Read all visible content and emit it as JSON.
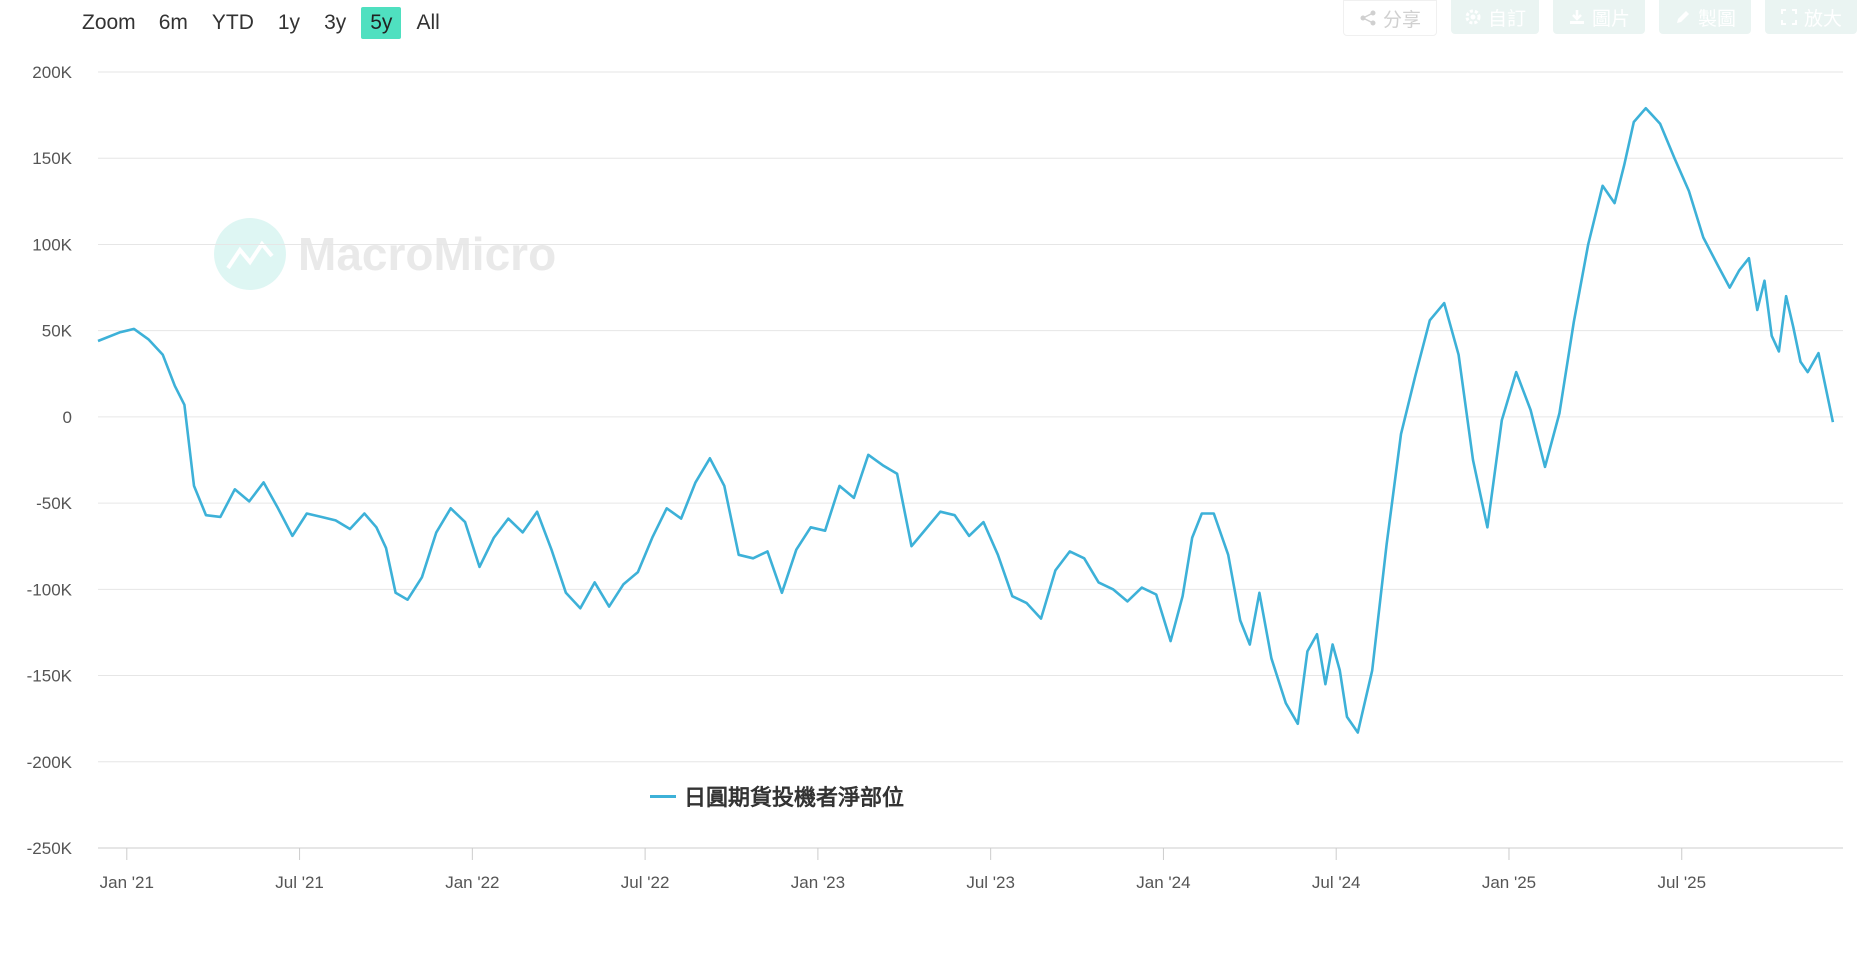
{
  "zoom": {
    "label": "Zoom",
    "options": [
      "6m",
      "YTD",
      "1y",
      "3y",
      "5y",
      "All"
    ],
    "active": "5y"
  },
  "toolbar": {
    "share": "分享",
    "custom": "自訂",
    "image": "圖片",
    "draw": "製圖",
    "expand": "放大"
  },
  "watermark": "MacroMicro",
  "colors": {
    "line": "#3db1d8",
    "active_zoom": "#4fe0c0",
    "grid": "#e6e6e6"
  },
  "chart_data": {
    "type": "line",
    "title": "",
    "xlabel": "",
    "ylabel": "",
    "ylim": [
      -250000,
      200000
    ],
    "y_ticks": [
      "200K",
      "150K",
      "100K",
      "50K",
      "0",
      "-50K",
      "-100K",
      "-150K",
      "-200K",
      "-250K"
    ],
    "y_tick_values": [
      200000,
      150000,
      100000,
      50000,
      0,
      -50000,
      -100000,
      -150000,
      -200000,
      -250000
    ],
    "x_ticks": [
      "Jan '21",
      "Jul '21",
      "Jan '22",
      "Jul '22",
      "Jan '23",
      "Jul '23",
      "Jan '24",
      "Jul '24",
      "Jan '25",
      "Jul '25"
    ],
    "x_tick_dates": [
      "2021-01",
      "2021-07",
      "2022-01",
      "2022-07",
      "2023-01",
      "2023-07",
      "2024-01",
      "2024-07",
      "2025-01",
      "2025-07"
    ],
    "xlim": [
      "2020-12",
      "2025-12"
    ],
    "legend_position": "bottom-center",
    "series": [
      {
        "name": "日圓期貨投機者淨部位",
        "points": [
          [
            "2020-12",
            44000
          ],
          [
            "2021-01",
            49000
          ],
          [
            "2021-01",
            51000
          ],
          [
            "2021-02",
            45000
          ],
          [
            "2021-02",
            36000
          ],
          [
            "2021-03",
            18000
          ],
          [
            "2021-03",
            7000
          ],
          [
            "2021-03",
            -40000
          ],
          [
            "2021-04",
            -57000
          ],
          [
            "2021-04",
            -58000
          ],
          [
            "2021-05",
            -42000
          ],
          [
            "2021-05",
            -49000
          ],
          [
            "2021-06",
            -38000
          ],
          [
            "2021-06",
            -53000
          ],
          [
            "2021-07",
            -69000
          ],
          [
            "2021-07",
            -56000
          ],
          [
            "2021-08",
            -58000
          ],
          [
            "2021-08",
            -60000
          ],
          [
            "2021-09",
            -65000
          ],
          [
            "2021-09",
            -56000
          ],
          [
            "2021-10",
            -64000
          ],
          [
            "2021-10",
            -76000
          ],
          [
            "2021-10",
            -102000
          ],
          [
            "2021-11",
            -106000
          ],
          [
            "2021-11",
            -93000
          ],
          [
            "2021-12",
            -67000
          ],
          [
            "2021-12",
            -53000
          ],
          [
            "2022-01",
            -61000
          ],
          [
            "2022-01",
            -87000
          ],
          [
            "2022-02",
            -70000
          ],
          [
            "2022-02",
            -59000
          ],
          [
            "2022-03",
            -67000
          ],
          [
            "2022-03",
            -55000
          ],
          [
            "2022-04",
            -77000
          ],
          [
            "2022-04",
            -102000
          ],
          [
            "2022-05",
            -111000
          ],
          [
            "2022-05",
            -96000
          ],
          [
            "2022-06",
            -110000
          ],
          [
            "2022-06",
            -97000
          ],
          [
            "2022-07",
            -90000
          ],
          [
            "2022-07",
            -70000
          ],
          [
            "2022-08",
            -53000
          ],
          [
            "2022-08",
            -59000
          ],
          [
            "2022-09",
            -38000
          ],
          [
            "2022-09",
            -24000
          ],
          [
            "2022-10",
            -40000
          ],
          [
            "2022-10",
            -80000
          ],
          [
            "2022-11",
            -82000
          ],
          [
            "2022-11",
            -78000
          ],
          [
            "2022-12",
            -102000
          ],
          [
            "2022-12",
            -77000
          ],
          [
            "2023-01",
            -64000
          ],
          [
            "2023-01",
            -66000
          ],
          [
            "2023-02",
            -40000
          ],
          [
            "2023-02",
            -47000
          ],
          [
            "2023-03",
            -22000
          ],
          [
            "2023-03",
            -28000
          ],
          [
            "2023-04",
            -33000
          ],
          [
            "2023-04",
            -75000
          ],
          [
            "2023-05",
            -65000
          ],
          [
            "2023-05",
            -55000
          ],
          [
            "2023-06",
            -57000
          ],
          [
            "2023-06",
            -69000
          ],
          [
            "2023-07",
            -61000
          ],
          [
            "2023-07",
            -80000
          ],
          [
            "2023-08",
            -104000
          ],
          [
            "2023-08",
            -108000
          ],
          [
            "2023-09",
            -117000
          ],
          [
            "2023-09",
            -89000
          ],
          [
            "2023-10",
            -78000
          ],
          [
            "2023-10",
            -82000
          ],
          [
            "2023-11",
            -96000
          ],
          [
            "2023-11",
            -100000
          ],
          [
            "2023-12",
            -107000
          ],
          [
            "2023-12",
            -99000
          ],
          [
            "2024-01",
            -103000
          ],
          [
            "2024-01",
            -130000
          ],
          [
            "2024-02",
            -104000
          ],
          [
            "2024-02",
            -70000
          ],
          [
            "2024-02",
            -56000
          ],
          [
            "2024-03",
            -56000
          ],
          [
            "2024-03",
            -80000
          ],
          [
            "2024-04",
            -118000
          ],
          [
            "2024-04",
            -132000
          ],
          [
            "2024-04",
            -102000
          ],
          [
            "2024-05",
            -140000
          ],
          [
            "2024-05",
            -166000
          ],
          [
            "2024-06",
            -178000
          ],
          [
            "2024-06",
            -136000
          ],
          [
            "2024-06",
            -126000
          ],
          [
            "2024-07",
            -155000
          ],
          [
            "2024-07",
            -132000
          ],
          [
            "2024-07",
            -147000
          ],
          [
            "2024-07",
            -174000
          ],
          [
            "2024-08",
            -183000
          ],
          [
            "2024-08",
            -147000
          ],
          [
            "2024-09",
            -74000
          ],
          [
            "2024-09",
            -10000
          ],
          [
            "2024-10",
            24000
          ],
          [
            "2024-10",
            56000
          ],
          [
            "2024-11",
            66000
          ],
          [
            "2024-11",
            36000
          ],
          [
            "2024-12",
            -25000
          ],
          [
            "2024-12",
            -64000
          ],
          [
            "2025-01",
            -2000
          ],
          [
            "2025-01",
            26000
          ],
          [
            "2025-02",
            4000
          ],
          [
            "2025-02",
            -29000
          ],
          [
            "2025-03",
            2000
          ],
          [
            "2025-03",
            55000
          ],
          [
            "2025-04",
            100000
          ],
          [
            "2025-04",
            134000
          ],
          [
            "2025-05",
            124000
          ],
          [
            "2025-05",
            146000
          ],
          [
            "2025-05",
            171000
          ],
          [
            "2025-06",
            179000
          ],
          [
            "2025-06",
            170000
          ],
          [
            "2025-07",
            150000
          ],
          [
            "2025-07",
            131000
          ],
          [
            "2025-08",
            104000
          ],
          [
            "2025-08",
            88000
          ],
          [
            "2025-09",
            75000
          ],
          [
            "2025-09",
            85000
          ],
          [
            "2025-09",
            92000
          ],
          [
            "2025-10",
            62000
          ],
          [
            "2025-10",
            79000
          ],
          [
            "2025-10",
            47000
          ],
          [
            "2025-10",
            38000
          ],
          [
            "2025-11",
            70000
          ],
          [
            "2025-11",
            52000
          ],
          [
            "2025-11",
            32000
          ],
          [
            "2025-11",
            26000
          ],
          [
            "2025-12",
            37000
          ],
          [
            "2025-12",
            -3000
          ]
        ]
      }
    ]
  }
}
